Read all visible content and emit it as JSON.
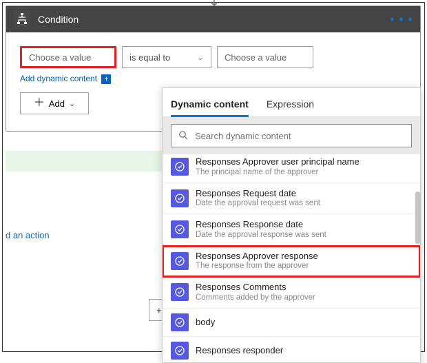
{
  "condition": {
    "title": "Condition",
    "value1_placeholder": "Choose a value",
    "operator": "is equal to",
    "value2_placeholder": "Choose a value",
    "dynamic_link": "Add dynamic content",
    "add_btn": "Add"
  },
  "partial": {
    "an_action": "d an action",
    "new_btn": "+  Ne"
  },
  "popup": {
    "tabs": {
      "dynamic": "Dynamic content",
      "expression": "Expression"
    },
    "search_placeholder": "Search dynamic content"
  },
  "items": [
    {
      "title": "Responses Approver user principal name",
      "sub": "The principal name of the approver"
    },
    {
      "title": "Responses Request date",
      "sub": "Date the approval request was sent"
    },
    {
      "title": "Responses Response date",
      "sub": "Date the approval response was sent"
    },
    {
      "title": "Responses Approver response",
      "sub": "The response from the approver"
    },
    {
      "title": "Responses Comments",
      "sub": "Comments added by the approver"
    },
    {
      "title": "body",
      "sub": ""
    },
    {
      "title": "Responses responder",
      "sub": ""
    }
  ]
}
